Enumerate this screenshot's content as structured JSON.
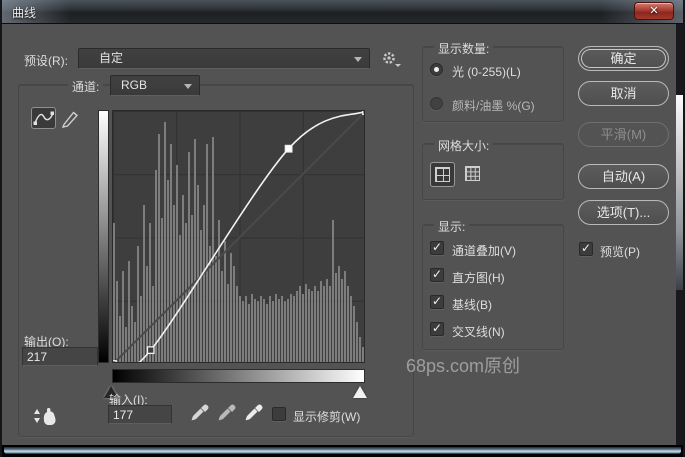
{
  "window": {
    "title": "曲线",
    "close_glyph": "✕"
  },
  "icons": {
    "check": "✓"
  },
  "preset": {
    "label": "预设(R):",
    "value": "自定"
  },
  "channel": {
    "label": "通道:",
    "value": "RGB"
  },
  "output": {
    "label": "输出(O):",
    "value": "217"
  },
  "input": {
    "label": "输入(I):",
    "value": "177"
  },
  "show_clipping": {
    "label": "显示修剪(W)",
    "checked": false
  },
  "display_amount": {
    "title": "显示数量:",
    "options": [
      {
        "label": "光 (0-255)(L)",
        "selected": true
      },
      {
        "label": "颜料/油墨 %(G)",
        "selected": false
      }
    ]
  },
  "grid_size": {
    "title": "网格大小:",
    "selected": "coarse"
  },
  "show_group": {
    "title": "显示:",
    "items": [
      {
        "label": "通道叠加(V)",
        "checked": true
      },
      {
        "label": "直方图(H)",
        "checked": true
      },
      {
        "label": "基线(B)",
        "checked": true
      },
      {
        "label": "交叉线(N)",
        "checked": true
      }
    ]
  },
  "buttons": {
    "ok": "确定",
    "cancel": "取消",
    "smooth": "平滑(M)",
    "auto": "自动(A)",
    "options": "选项(T)...",
    "preview": "预览(P)",
    "preview_checked": true
  },
  "watermark": "68ps.com原创",
  "curve": {
    "points": [
      {
        "input": 0,
        "output": 0,
        "selected": false
      },
      {
        "input": 38,
        "output": 14,
        "selected": false
      },
      {
        "input": 177,
        "output": 217,
        "selected": true
      },
      {
        "input": 255,
        "output": 255,
        "selected": false
      }
    ]
  },
  "histogram": [
    55,
    32,
    18,
    36,
    14,
    40,
    22,
    16,
    46,
    26,
    62,
    38,
    55,
    30,
    76,
    90,
    57,
    95,
    72,
    86,
    62,
    78,
    50,
    66,
    55,
    83,
    58,
    88,
    70,
    52,
    62,
    86,
    46,
    89,
    42,
    56,
    36,
    48,
    31,
    43,
    38,
    30,
    26,
    24,
    26,
    23,
    27,
    25,
    24,
    26,
    25,
    23,
    26,
    24,
    27,
    25,
    26,
    24,
    25,
    27,
    26,
    28,
    30,
    27,
    31,
    29,
    28,
    30,
    28,
    32,
    30,
    33,
    30,
    56,
    35,
    38,
    33,
    36,
    30,
    26,
    22,
    16,
    10,
    6
  ],
  "colors": {
    "panel": "#535353",
    "grid_bg": "#3e3e3e",
    "histogram_bar": "#7d7d7d",
    "curve": "#f2f2f2",
    "close_red": "#a3392c"
  }
}
